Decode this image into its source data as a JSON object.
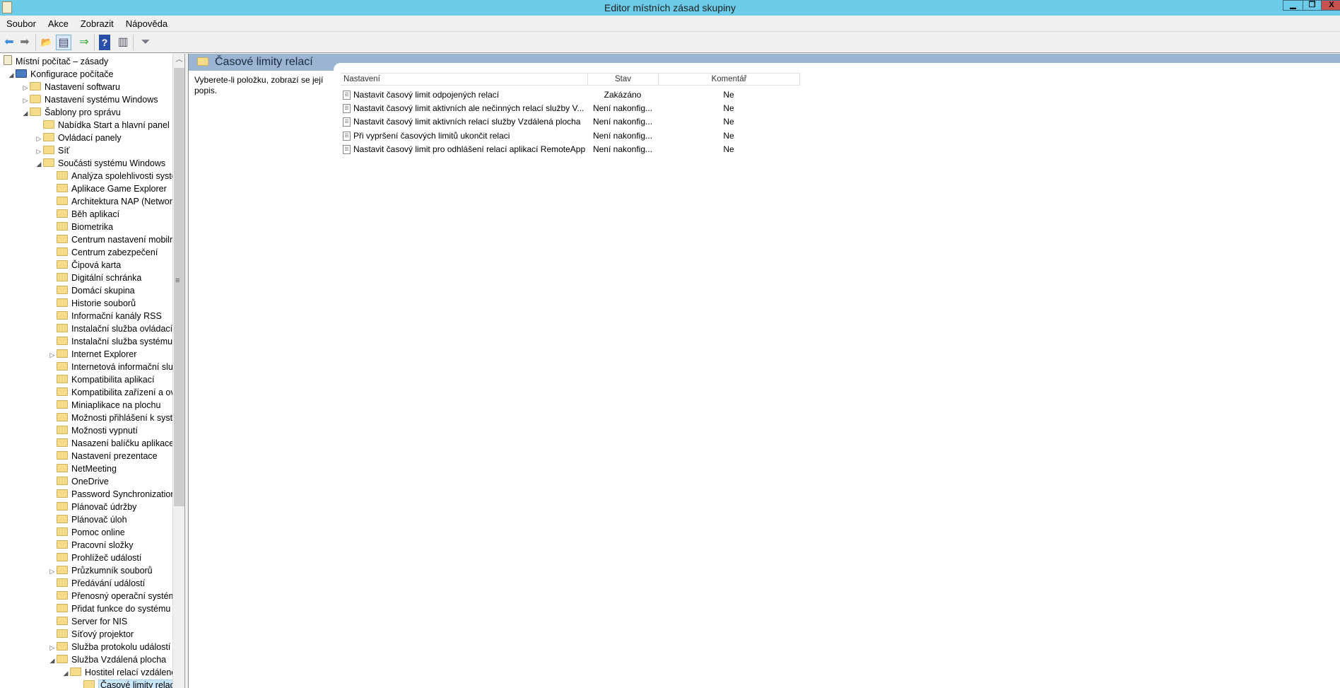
{
  "window": {
    "title": "Editor místních zásad skupiny",
    "minimize": "▁",
    "restore": "❐",
    "close": "X",
    "close_color": "#c75050"
  },
  "menu": [
    "Soubor",
    "Akce",
    "Zobrazit",
    "Nápověda"
  ],
  "toolbar": [
    {
      "icon": "back-icon",
      "glyph": "⬅"
    },
    {
      "icon": "forward-icon",
      "glyph": "➡"
    },
    {
      "icon": "up-folder-icon",
      "glyph": "📂"
    },
    {
      "icon": "show-hide-tree-icon",
      "glyph": "▤"
    },
    {
      "icon": "export-list-icon",
      "glyph": "⇒"
    },
    {
      "icon": "help-icon",
      "glyph": "?"
    },
    {
      "icon": "show-action-pane-icon",
      "glyph": "▥"
    },
    {
      "icon": "filter-icon",
      "glyph": "⏷"
    }
  ],
  "tree": {
    "root": "Místní počítač – zásady",
    "items": [
      {
        "label": "Konfigurace počítače",
        "level": 1,
        "exp": "◢"
      },
      {
        "label": "Nastavení softwaru",
        "level": 2,
        "exp": "▷"
      },
      {
        "label": "Nastavení systému Windows",
        "level": 2,
        "exp": "▷"
      },
      {
        "label": "Šablony pro správu",
        "level": 2,
        "exp": "◢"
      },
      {
        "label": "Nabídka Start a hlavní panel",
        "level": 3,
        "exp": ""
      },
      {
        "label": "Ovládací panely",
        "level": 3,
        "exp": "▷"
      },
      {
        "label": "Síť",
        "level": 3,
        "exp": "▷"
      },
      {
        "label": "Součásti systému Windows",
        "level": 3,
        "exp": "◢"
      },
      {
        "label": "Analýza spolehlivosti systému",
        "level": 4,
        "exp": ""
      },
      {
        "label": "Aplikace Game Explorer",
        "level": 4,
        "exp": ""
      },
      {
        "label": "Architektura NAP (Network",
        "level": 4,
        "exp": ""
      },
      {
        "label": "Běh aplikací",
        "level": 4,
        "exp": ""
      },
      {
        "label": "Biometrika",
        "level": 4,
        "exp": ""
      },
      {
        "label": "Centrum nastavení mobilních",
        "level": 4,
        "exp": ""
      },
      {
        "label": "Centrum zabezpečení",
        "level": 4,
        "exp": ""
      },
      {
        "label": "Čipová karta",
        "level": 4,
        "exp": ""
      },
      {
        "label": "Digitální schránka",
        "level": 4,
        "exp": ""
      },
      {
        "label": "Domácí skupina",
        "level": 4,
        "exp": ""
      },
      {
        "label": "Historie souborů",
        "level": 4,
        "exp": ""
      },
      {
        "label": "Informační kanály RSS",
        "level": 4,
        "exp": ""
      },
      {
        "label": "Instalační služba ovládacích",
        "level": 4,
        "exp": ""
      },
      {
        "label": "Instalační služba systému W",
        "level": 4,
        "exp": ""
      },
      {
        "label": "Internet Explorer",
        "level": 4,
        "exp": "▷"
      },
      {
        "label": "Internetová informační služ",
        "level": 4,
        "exp": ""
      },
      {
        "label": "Kompatibilita aplikací",
        "level": 4,
        "exp": ""
      },
      {
        "label": "Kompatibilita zařízení a ovla",
        "level": 4,
        "exp": ""
      },
      {
        "label": "Miniaplikace na plochu",
        "level": 4,
        "exp": ""
      },
      {
        "label": "Možnosti přihlášení k systém",
        "level": 4,
        "exp": ""
      },
      {
        "label": "Možnosti vypnutí",
        "level": 4,
        "exp": ""
      },
      {
        "label": "Nasazení balíčku aplikace",
        "level": 4,
        "exp": ""
      },
      {
        "label": "Nastavení prezentace",
        "level": 4,
        "exp": ""
      },
      {
        "label": "NetMeeting",
        "level": 4,
        "exp": ""
      },
      {
        "label": "OneDrive",
        "level": 4,
        "exp": ""
      },
      {
        "label": "Password Synchronization",
        "level": 4,
        "exp": ""
      },
      {
        "label": "Plánovač údržby",
        "level": 4,
        "exp": ""
      },
      {
        "label": "Plánovač úloh",
        "level": 4,
        "exp": ""
      },
      {
        "label": "Pomoc online",
        "level": 4,
        "exp": ""
      },
      {
        "label": "Pracovní složky",
        "level": 4,
        "exp": ""
      },
      {
        "label": "Prohlížeč událostí",
        "level": 4,
        "exp": ""
      },
      {
        "label": "Průzkumník souborů",
        "level": 4,
        "exp": "▷"
      },
      {
        "label": "Předávání událostí",
        "level": 4,
        "exp": ""
      },
      {
        "label": "Přenosný operační systém",
        "level": 4,
        "exp": ""
      },
      {
        "label": "Přidat funkce do systému W",
        "level": 4,
        "exp": ""
      },
      {
        "label": "Server for NIS",
        "level": 4,
        "exp": ""
      },
      {
        "label": "Síťový projektor",
        "level": 4,
        "exp": ""
      },
      {
        "label": "Služba protokolu událostí",
        "level": 4,
        "exp": "▷"
      },
      {
        "label": "Služba Vzdálená plocha",
        "level": 4,
        "exp": "◢"
      },
      {
        "label": "Hostitel relací vzdálené",
        "level": 5,
        "exp": "◢"
      },
      {
        "label": "Časové limity relací",
        "level": 6,
        "exp": "",
        "selected": true
      }
    ]
  },
  "main": {
    "header": "Časové limity relací",
    "description": "Vyberete-li položku, zobrazí se její popis.",
    "columns": [
      "Nastavení",
      "Stav",
      "Komentář"
    ],
    "rows": [
      {
        "setting": "Nastavit časový limit odpojených relací",
        "state": "Zakázáno",
        "comment": "Ne"
      },
      {
        "setting": "Nastavit časový limit aktivních ale nečinných relací služby V...",
        "state": "Není nakonfig...",
        "comment": "Ne"
      },
      {
        "setting": "Nastavit časový limit aktivních relací služby Vzdálená plocha",
        "state": "Není nakonfig...",
        "comment": "Ne"
      },
      {
        "setting": "Při vypršení časových limitů ukončit relaci",
        "state": "Není nakonfig...",
        "comment": "Ne"
      },
      {
        "setting": "Nastavit časový limit pro odhlášení relací aplikací RemoteApp",
        "state": "Není nakonfig...",
        "comment": "Ne"
      }
    ]
  }
}
